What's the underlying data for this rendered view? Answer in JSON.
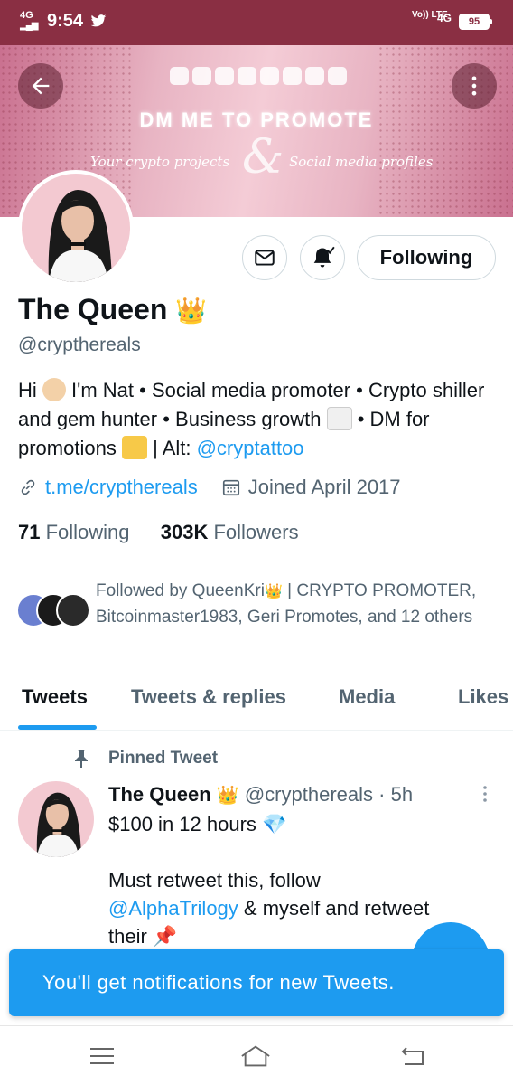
{
  "status_bar": {
    "network": "4G",
    "time": "9:54",
    "volte": "Vo)) LTE",
    "network_right": "4G",
    "battery": "95"
  },
  "banner": {
    "title": "DM ME TO PROMOTE",
    "left_text": "Your crypto projects",
    "amp": "&",
    "right_text": "Social media profiles"
  },
  "profile": {
    "name": "The Queen",
    "handle": "@crypthereals",
    "following_button": "Following",
    "bio_part1": "Hi",
    "bio_part2": " I'm Nat • Social media promoter • Crypto shiller and gem hunter • Business growth ",
    "bio_part3": " • DM for promotions ",
    "bio_part4": " | Alt: ",
    "bio_link": "@cryptattoo",
    "website": "t.me/crypthereals",
    "joined": "Joined April 2017",
    "following_count": "71",
    "following_label": " Following",
    "followers_count": "303K",
    "followers_label": " Followers",
    "followed_by": "Followed by QueenKri",
    "followed_by_rest": " | CRYPTO PROMOTER, Bitcoinmaster1983, Geri Promotes, and 12 others"
  },
  "tabs": [
    "Tweets",
    "Tweets & replies",
    "Media",
    "Likes"
  ],
  "pinned": {
    "label": "Pinned Tweet",
    "name": "The Queen",
    "handle": "@crypthereals",
    "time": "· 5h",
    "line1": "$100 in 12 hours ",
    "line2": "Must retweet this, follow",
    "mention": "@AlphaTrilogy",
    "line3": " & myself and retweet",
    "line4": "their "
  },
  "toast": "You'll get notifications for new Tweets.",
  "colors": {
    "accent": "#1d9bf0",
    "status_bar": "#8a2f43",
    "text_secondary": "#536471"
  }
}
